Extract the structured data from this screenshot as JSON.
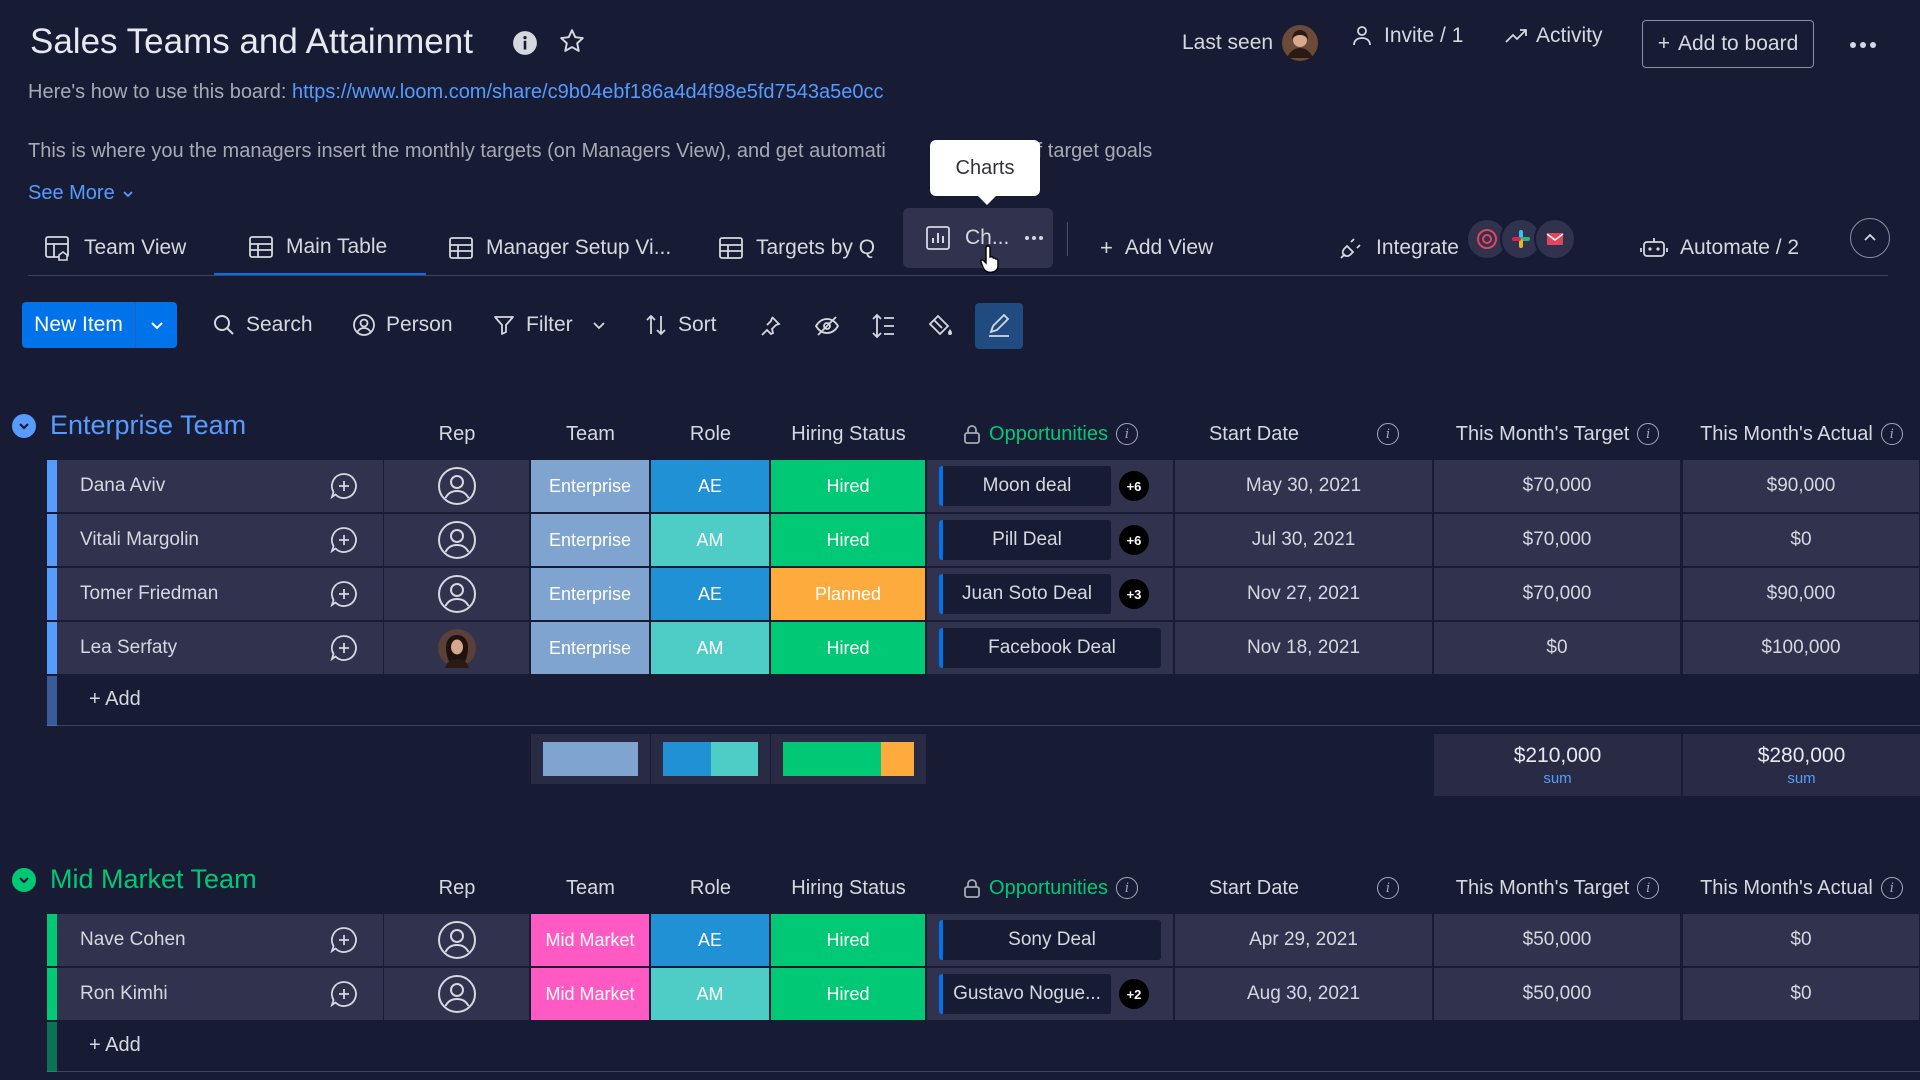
{
  "header": {
    "title": "Sales Teams and Attainment",
    "last_seen": "Last seen",
    "invite": "Invite / 1",
    "activity": "Activity",
    "add_to_board": "Add to board",
    "desc_prefix": "Here's how to use this board:",
    "desc_link": "https://www.loom.com/share/c9b04ebf186a4d4f98e5fd7543a5e0cc",
    "desc2_left": "This is where you the managers insert the monthly targets (on Managers View), and get automati",
    "desc2_right": "ns of target goals",
    "see_more": "See More"
  },
  "tooltip": "Charts",
  "tabs": [
    {
      "label": "Team View"
    },
    {
      "label": "Main Table"
    },
    {
      "label": "Manager Setup Vi..."
    },
    {
      "label": "Targets by Q"
    },
    {
      "label": "Ch..."
    }
  ],
  "add_view": "Add View",
  "integrate": "Integrate",
  "automate": "Automate / 2",
  "toolbar": {
    "new_item": "New Item",
    "search": "Search",
    "person": "Person",
    "filter": "Filter",
    "sort": "Sort"
  },
  "columns": {
    "rep": "Rep",
    "team": "Team",
    "role": "Role",
    "hiring": "Hiring Status",
    "opps": "Opportunities",
    "start": "Start Date",
    "target": "This Month's Target",
    "actual": "This Month's Actual"
  },
  "groups": [
    {
      "title": "Enterprise Team",
      "color": "#579bfc",
      "add_label": "+ Add",
      "rows": [
        {
          "name": "Dana Aviv",
          "team": "Enterprise",
          "role": "AE",
          "status": "Hired",
          "opp": "Moon deal",
          "opp_extra": "+6",
          "start": "May 30, 2021",
          "target": "$70,000",
          "actual": "$90,000"
        },
        {
          "name": "Vitali Margolin",
          "team": "Enterprise",
          "role": "AM",
          "status": "Hired",
          "opp": "Pill Deal",
          "opp_extra": "+6",
          "start": "Jul 30, 2021",
          "target": "$70,000",
          "actual": "$0"
        },
        {
          "name": "Tomer Friedman",
          "team": "Enterprise",
          "role": "AE",
          "status": "Planned",
          "opp": "Juan Soto Deal",
          "opp_extra": "+3",
          "start": "Nov 27, 2021",
          "target": "$70,000",
          "actual": "$90,000"
        },
        {
          "name": "Lea Serfaty",
          "team": "Enterprise",
          "role": "AM",
          "status": "Hired",
          "opp": "Facebook Deal",
          "opp_extra": "",
          "start": "Nov 18, 2021",
          "target": "$0",
          "actual": "$100,000"
        }
      ],
      "sum_target": "$210,000",
      "sum_actual": "$280,000",
      "sum_label": "sum"
    },
    {
      "title": "Mid Market Team",
      "color": "#00c875",
      "add_label": "+ Add",
      "rows": [
        {
          "name": "Nave Cohen",
          "team": "Mid Market",
          "role": "AE",
          "status": "Hired",
          "opp": "Sony Deal",
          "opp_extra": "",
          "start": "Apr 29, 2021",
          "target": "$50,000",
          "actual": "$0"
        },
        {
          "name": "Ron Kimhi",
          "team": "Mid Market",
          "role": "AM",
          "status": "Hired",
          "opp": "Gustavo Nogue...",
          "opp_extra": "+2",
          "start": "Aug 30, 2021",
          "target": "$50,000",
          "actual": "$0"
        }
      ]
    }
  ],
  "colors": {
    "enterprise": "#7fa4cf",
    "mid_market": "#ff5ac4",
    "ae": "#1f91d4",
    "am": "#4eccc6",
    "hired": "#00c875",
    "planned": "#fdab3d",
    "accent": "#0073ea"
  }
}
